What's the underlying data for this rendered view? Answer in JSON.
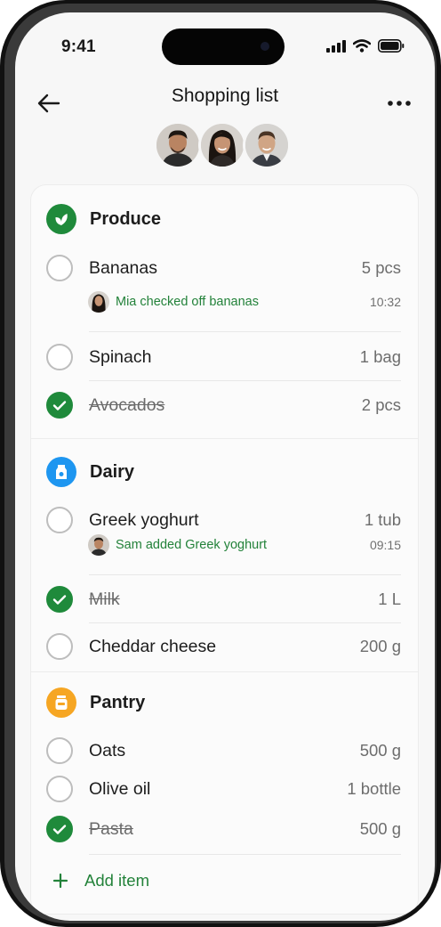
{
  "status": {
    "time": "9:41"
  },
  "header": {
    "title": "Shopping list"
  },
  "colors": {
    "accent_green": "#1f8a3b",
    "produce": "#1f8a3b",
    "dairy": "#1e96f0",
    "pantry": "#f6a623"
  },
  "members": [
    "woman-avatar",
    "man-avatar",
    "man-avatar"
  ],
  "sections": [
    {
      "label": "Produce",
      "icon": "leaf-icon",
      "items": [
        {
          "name": "Bananas",
          "qty": "5 pcs",
          "checked": false
        },
        {
          "name": "Spinach",
          "qty": "1 bag",
          "checked": false
        },
        {
          "name": "Avocados",
          "qty": "2 pcs",
          "checked": true
        }
      ],
      "activity": {
        "text": "Mia checked off bananas",
        "time": "10:32"
      }
    },
    {
      "label": "Dairy",
      "icon": "milk-carton-icon",
      "items": [
        {
          "name": "Greek yoghurt",
          "qty": "1 tub",
          "checked": false
        },
        {
          "name": "Milk",
          "qty": "1 L",
          "checked": true
        },
        {
          "name": "Cheddar cheese",
          "qty": "200 g",
          "checked": false
        }
      ],
      "activity": {
        "text": "Sam added Greek yoghurt",
        "time": "09:15"
      }
    },
    {
      "label": "Pantry",
      "icon": "jar-icon",
      "items": [
        {
          "name": "Oats",
          "qty": "500 g",
          "checked": false
        },
        {
          "name": "Olive oil",
          "qty": "1 bottle",
          "checked": false
        },
        {
          "name": "Pasta",
          "qty": "500 g",
          "checked": true
        }
      ]
    }
  ],
  "add_item": {
    "label": "Add item"
  }
}
